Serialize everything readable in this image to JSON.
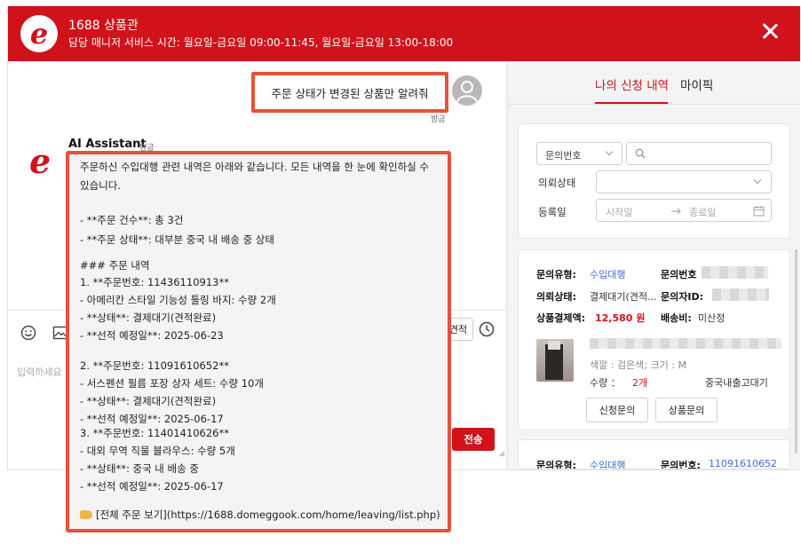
{
  "header": {
    "title": "1688 상품관",
    "subtitle": "담당 매니저 서비스 시간: 월요일-금요일 09:00-11:45, 월요일-금요일 13:00-18:00",
    "brand_color": "#d0121b"
  },
  "chat": {
    "user_message": "주문 상태가 변경된 상품만 알려줘",
    "user_time": "방금",
    "assistant_name": "AI Assistant",
    "assistant_time": "방금",
    "assistant_reply": {
      "intro": "주문하신 수입대행 관련 내역은 아래와 같습니다. 모든 내역을 한 눈에 확인하실 수 있습니다.",
      "summary": [
        "- **주문 건수**: 총 3건",
        "- **주문 상태**: 대부분 중국 내 배송 중 상태"
      ],
      "section_heading": "### 주문 내역",
      "orders": [
        {
          "line1": "1. **주문번호: 11436110913**",
          "line2": "- 아메리칸 스타일 기능성 툴링 바지: 수량 2개",
          "line3": "- **상태**: 결제대기(견적완료)",
          "line4": "- **선적 예정일**: 2025-06-23"
        },
        {
          "line1": "2. **주문번호: 11091610652**",
          "line2": "- 서스펜션 필름 포장 상자 세트: 수량 10개",
          "line3": "- **상태**: 결제대기(견적완료)",
          "line4": "- **선적 예정일**: 2025-06-17"
        },
        {
          "line1": "3. **주문번호: 11401410626**",
          "line2": "- 대외 무역 직물 블라우스: 수량 5개",
          "line3": "- **상태**: 중국 내 배송 중",
          "line4": "- **선적 예정일**: 2025-06-17"
        }
      ],
      "link_text": "[전체 주문 보기](https://1688.domeggook.com/home/leaving/list.php)"
    }
  },
  "composer": {
    "placeholder": "입력하세요",
    "quote_button": "견적",
    "send_button": "전송"
  },
  "side": {
    "tabs": [
      "나의 신청 내역",
      "마이픽"
    ],
    "filters": {
      "inquiry_select": "문의번호",
      "status_label": "의뢰상태",
      "date_label": "등록일",
      "start_placeholder": "시작일",
      "end_placeholder": "종료일"
    },
    "card": {
      "type_key": "문의유형:",
      "type_value": "수입대행",
      "inquiry_no_key": "문의번호",
      "status_key": "의뢰상태:",
      "status_value": "결제대기(견적...",
      "requester_key": "문의자ID:",
      "payment_key": "상품결제액:",
      "payment_value": "12,580 원",
      "shipping_key": "배송비:",
      "shipping_value": "미산정",
      "option_text": "색깔 : 검은색;  크기 : M",
      "qty_key": "수량 ：",
      "qty_value": "2개",
      "delivery_method": "중국내출고대기",
      "btn_request": "신청문의",
      "btn_product": "상품문의"
    },
    "card2": {
      "type_key": "문의유형:",
      "type_value": "수입대행",
      "inquiry_no_key": "문의번호:",
      "inquiry_no_value": "11091610652"
    }
  }
}
